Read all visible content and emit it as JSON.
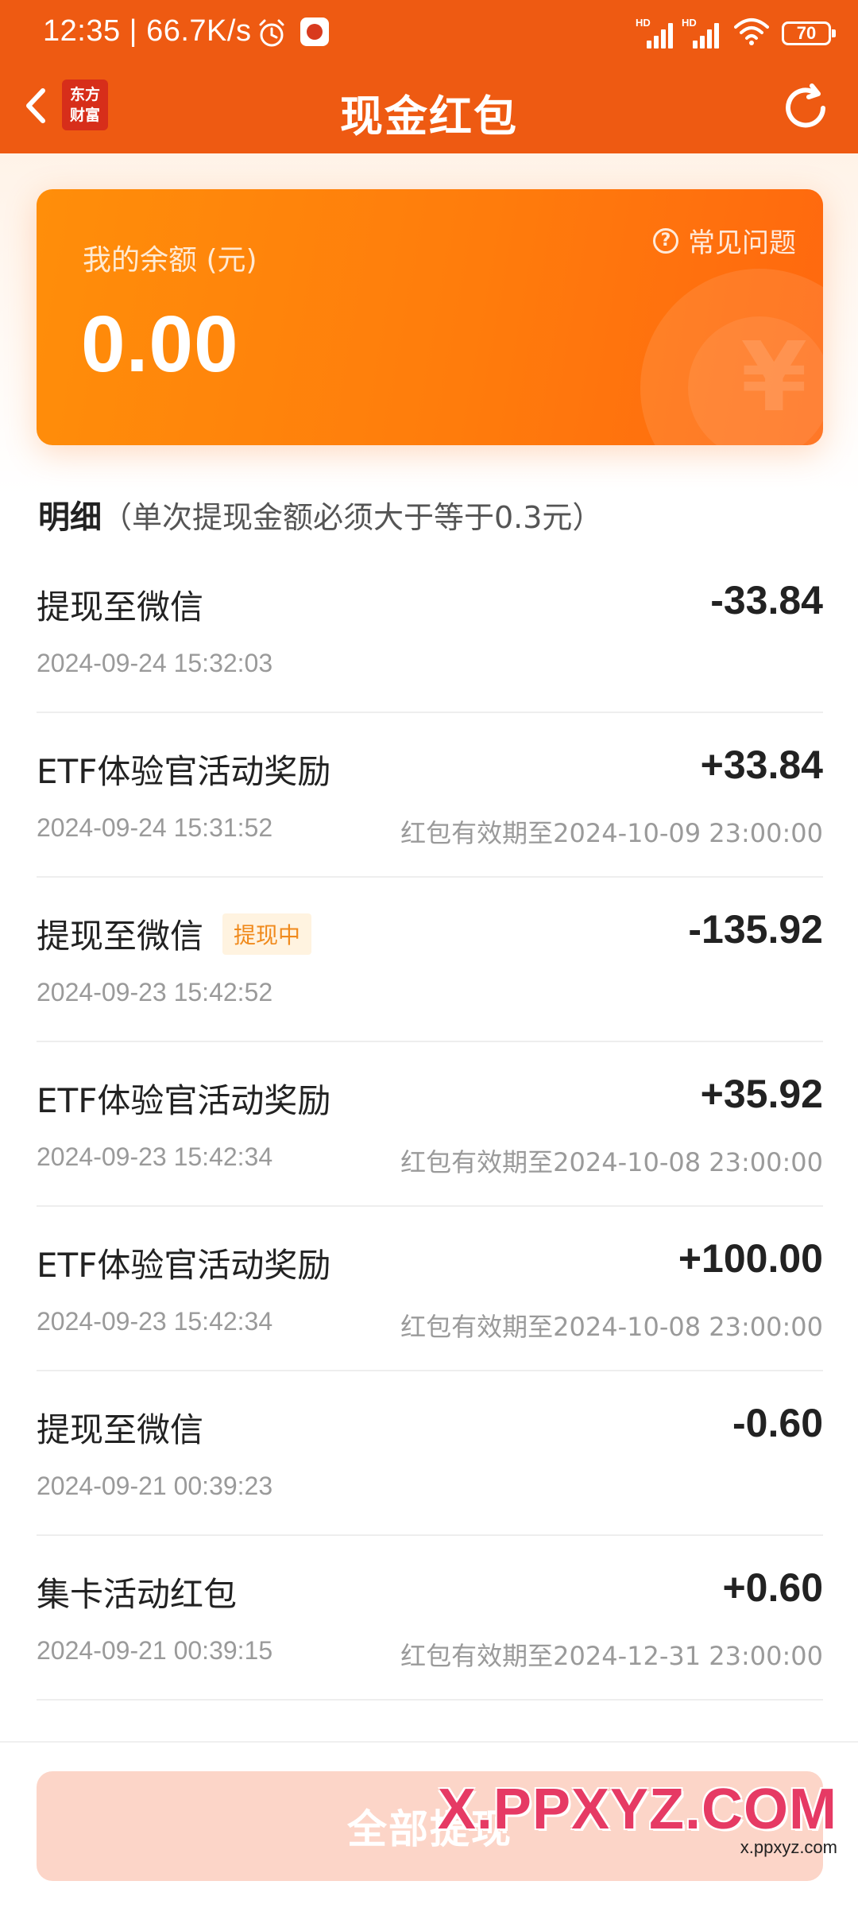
{
  "status_bar": {
    "time": "12:35 | 66.7K/s",
    "network_label_1": "HD",
    "network_label_2": "HD",
    "battery": "70"
  },
  "nav": {
    "title": "现金红包",
    "logo_line1": "东方",
    "logo_line2": "财富"
  },
  "balance": {
    "label": "我的余额 (元)",
    "value": "0.00",
    "faq_label": "常见问题",
    "deco_symbol": "¥"
  },
  "detail": {
    "title": "明细",
    "note": "（单次提现金额必须大于等于0.3元）",
    "items": [
      {
        "name": "提现至微信",
        "badge": "",
        "amount": "-33.84",
        "time": "2024-09-24 15:32:03",
        "expiry": ""
      },
      {
        "name": "ETF体验官活动奖励",
        "badge": "",
        "amount": "+33.84",
        "time": "2024-09-24 15:31:52",
        "expiry": "红包有效期至2024-10-09 23:00:00"
      },
      {
        "name": "提现至微信",
        "badge": "提现中",
        "amount": "-135.92",
        "time": "2024-09-23 15:42:52",
        "expiry": ""
      },
      {
        "name": "ETF体验官活动奖励",
        "badge": "",
        "amount": "+35.92",
        "time": "2024-09-23 15:42:34",
        "expiry": "红包有效期至2024-10-08 23:00:00"
      },
      {
        "name": "ETF体验官活动奖励",
        "badge": "",
        "amount": "+100.00",
        "time": "2024-09-23 15:42:34",
        "expiry": "红包有效期至2024-10-08 23:00:00"
      },
      {
        "name": "提现至微信",
        "badge": "",
        "amount": "-0.60",
        "time": "2024-09-21 00:39:23",
        "expiry": ""
      },
      {
        "name": "集卡活动红包",
        "badge": "",
        "amount": "+0.60",
        "time": "2024-09-21 00:39:15",
        "expiry": "红包有效期至2024-12-31 23:00:00"
      }
    ]
  },
  "bottom": {
    "withdraw_all_label": "全部提现"
  },
  "watermark": {
    "main": "X.PPXYZ.COM",
    "sub": "x.ppxyz.com"
  }
}
